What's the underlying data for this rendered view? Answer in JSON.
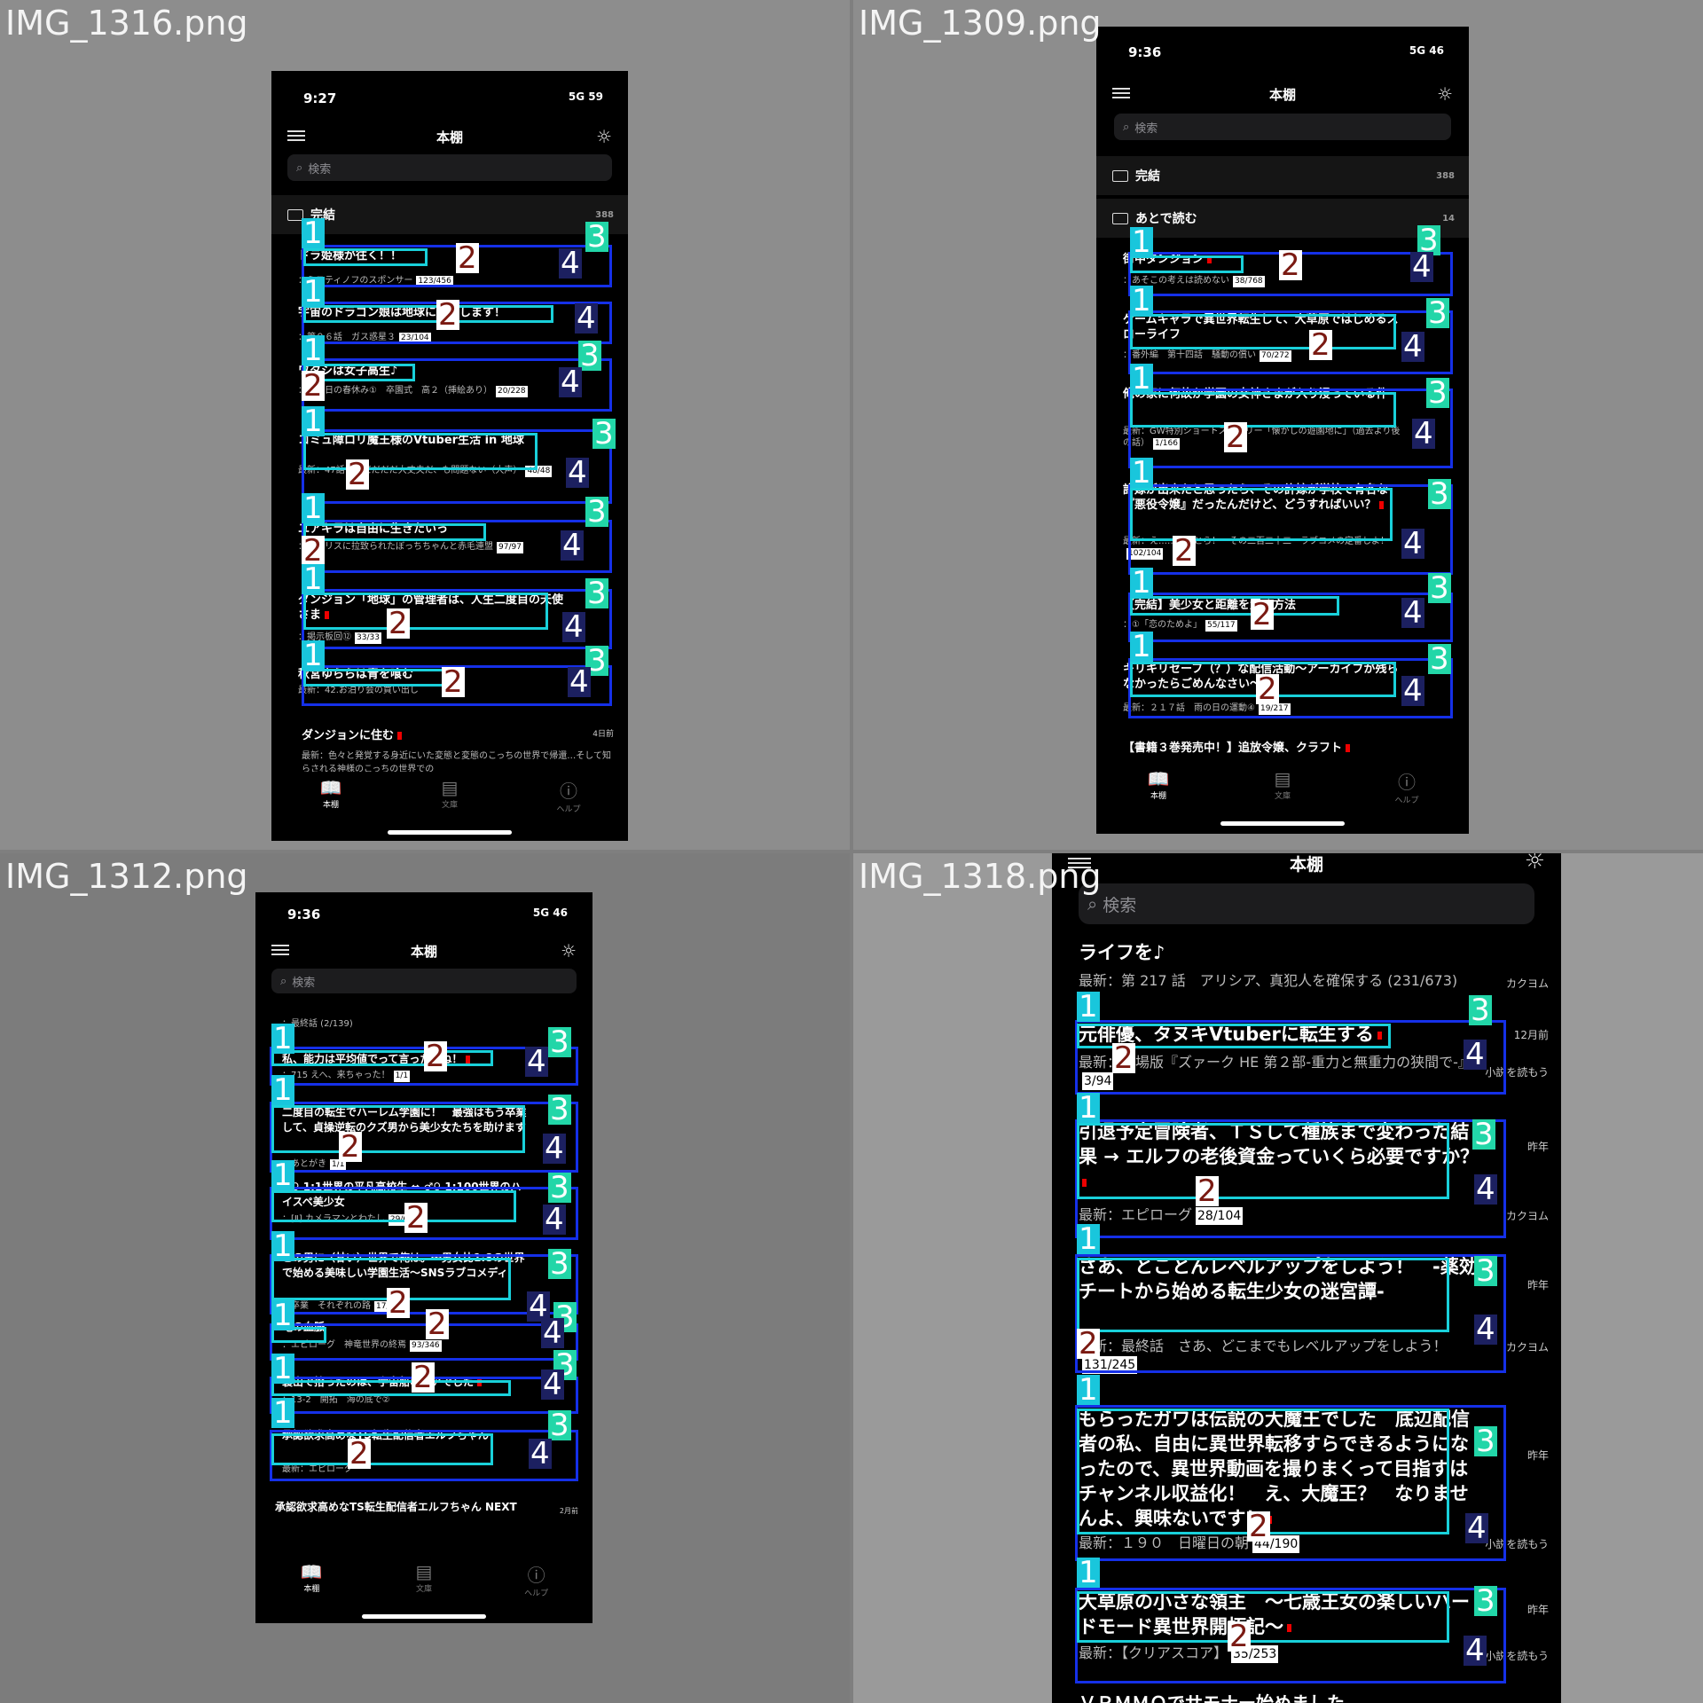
{
  "q1": {
    "filename": "IMG_1316.png",
    "time": "9:27",
    "signal": "5G 59",
    "nav_title": "本棚",
    "search_placeholder": "検索",
    "folder": {
      "name": "完結",
      "count": "388"
    },
    "rows": [
      {
        "title": "ドラ姫様が往く！！",
        "sub": "：ミスティノフのスポンサー",
        "prog": "123/456"
      },
      {
        "title": "宇宙のドラゴン娘は地球に配信します！",
        "sub": "：第９６話　ガス惑星３",
        "prog": "23/104"
      },
      {
        "title": "ワタシは女子高生♪",
        "sub": "：ある日の春休み①　卒園式　高２（挿絵あり）",
        "prog": "20/228"
      },
      {
        "title": "コミュ障ロリ魔王様のVtuber生活 in 地球",
        "sub": "最新：47話目　だだだだ大丈夫だ、も問題ない（大声）",
        "prog": "48/48"
      },
      {
        "title": "ユアキラは自由に生きたいっ",
        "sub": "：イギリスに拉致られたぼっちちゃんと赤毛連盟",
        "prog": "97/97"
      },
      {
        "title": "ダンジョン「地球」の管理者は、人生二度目の天使さま",
        "sub": "：掲示板回⑫",
        "prog": "33/33"
      },
      {
        "title": "秋宮ゆららは青を喰む",
        "sub": "最新：42.お泊り会の買い出し",
        "prog": ""
      }
    ],
    "tail": {
      "title": "ダンジョンに住む",
      "date": "4日前",
      "sub": "最新：色々と発覚する身近にいた変態と変態のこっちの世界で帰還…そして知らされる神様のこっちの世界での"
    },
    "tabs": [
      "本棚",
      "文庫",
      "ヘルプ"
    ]
  },
  "q2": {
    "filename": "IMG_1309.png",
    "time": "9:36",
    "signal": "5G 46",
    "nav_title": "本棚",
    "search_placeholder": "検索",
    "folder1": {
      "name": "完結",
      "count": "388"
    },
    "folder2": {
      "name": "あとで読む",
      "count": "14"
    },
    "rows": [
      {
        "title": "街中ダンジョン",
        "sub": "：あそこの考えは読めない",
        "prog": "38/768"
      },
      {
        "title": "ゲームキャラで異世界転生して、大草原ではじめるスローライフ",
        "sub": "：番外編　第十四話　騒動の償い",
        "prog": "70/272"
      },
      {
        "title": "俺の家に何故か学園の女神さまが入り浸っている件",
        "sub": "最新：GW特別ショートストーリー「懐かしの遊園地に」（過去より後の話）",
        "prog": "1/166"
      },
      {
        "title": "許嫁が出来たと思ったら、その許嫁が学校で有名な『悪役令嬢』だったんだけど、どうすればいい？",
        "sub": "最新：え……ぼくとら！　その二百二十二　ラブコメの定番しよ！",
        "prog": "102/104"
      },
      {
        "title": "【完結】美少女と距離を置く方法",
        "sub": "：①「恋のためよ」",
        "prog": "55/117"
      },
      {
        "title": "キリキリセーフ（？）な配信活動～アーカイブが残らなかったらごめんなさい～",
        "sub": "最新：２１７話　雨の日の運動④",
        "prog": "19/217"
      }
    ],
    "tail": {
      "title": "【書籍３巻発売中！】追放令嬢、クラフト"
    },
    "tabs": [
      "本棚",
      "文庫",
      "ヘルプ"
    ]
  },
  "q3": {
    "filename": "IMG_1312.png",
    "time": "9:36",
    "signal": "5G 46",
    "nav_title": "本棚",
    "search_placeholder": "検索",
    "top_sub": "：最終話 (2/139)",
    "rows": [
      {
        "title": "私、能力は平均値でって言ったよね！",
        "sub": "：715 えへ、来ちゃった！",
        "prog": "1/1"
      },
      {
        "title": "二度目の転生でハーレム学園に！　最強はもう卒業して、貞操逆転のクズ男から美少女たちを助けます",
        "sub": "：あとがき",
        "prog": "1/1"
      },
      {
        "title": "♂♀ 1:1世界の平凡高校生 ⇔ ♂♀ 1:100世界のハイスペ美少女",
        "sub": "：[Ⅱ] カメラマンとわたし",
        "prog": "29/61"
      },
      {
        "title": "この男に〈甘い〉世界で俺は。～男女比1:8の世界で始める美味しい学園生活～SNSラブコメディ",
        "sub": "：卒業　それぞれの路",
        "prog": "17/167"
      },
      {
        "title": "竜の血脈",
        "sub": "：エピローグ　神竜世界の終焉",
        "prog": "93/346"
      },
      {
        "title": "裏山で拾ったのは、宇宙船のコアでした",
        "sub": "：13-2　開拓　海の底で②",
        "prog": ""
      },
      {
        "title": "承認欲求高めなTS転生配信者エルフちゃん",
        "sub": "最新：エピローグ",
        "prog": ""
      }
    ],
    "tail": {
      "title": "承認欲求高めなTS転生配信者エルフちゃん NEXT",
      "date": "2月前"
    },
    "tabs": [
      "本棚",
      "文庫",
      "ヘルプ"
    ]
  },
  "q4": {
    "filename": "IMG_1318.png",
    "nav_title": "本棚",
    "search_placeholder": "検索",
    "top_title": "ライフを♪",
    "top_sub": "最新：第 217 話　アリシア、真犯人を確保する (231/673)",
    "top_site": "カクヨム",
    "rows": [
      {
        "title": "元俳優、タヌキVtuberに転生する",
        "sub": "最新：劇場版『ズァーク HE 第２部-重力と無重力の狭間で-』",
        "prog": "3/94",
        "date": "12月前",
        "site": "小説を読もう"
      },
      {
        "title": "引退予定冒険者、ＴＳして種族まで変わった結果 → エルフの老後資金っていくら必要ですか？",
        "sub": "最新：エピローグ",
        "prog": "28/104",
        "date": "昨年",
        "site": "カクヨム"
      },
      {
        "title": "さあ、とことんレベルアップをしよう！　-薬効チートから始める転生少女の迷宮譚-",
        "sub": "最新：最終話　さあ、どこまでもレベルアップをしよう！",
        "prog": "131/245",
        "date": "昨年",
        "site": "カクヨム"
      },
      {
        "title": "もらったガワは伝説の大魔王でした　底辺配信者の私、自由に異世界転移すらできるようになったので、異世界動画を撮りまくって目指すはチャンネル収益化！　え、大魔王？　なりませんよ、興味ないです！",
        "sub": "最新：１９０　日曜日の朝",
        "prog": "44/190",
        "date": "昨年",
        "site": "小説を読もう"
      },
      {
        "title": "大草原の小さな領主　～七歳王女の楽しいハードモード異世界開拓記～",
        "sub": "最新：【クリアスコア】",
        "prog": "35/253",
        "date": "昨年",
        "site": "小説を読もう"
      }
    ],
    "tail": {
      "title": "ＶＲＭＭＯでサモナー始めました"
    }
  },
  "labels": {
    "one": "1",
    "two": "2",
    "three": "3",
    "four": "4"
  },
  "colors": {
    "box_blue": "#1530e8",
    "box_cyan": "#19d0da",
    "label1": "#19c6dc",
    "label3": "#22d6a8",
    "label4": "#1c2060",
    "flag": "#e00000"
  }
}
